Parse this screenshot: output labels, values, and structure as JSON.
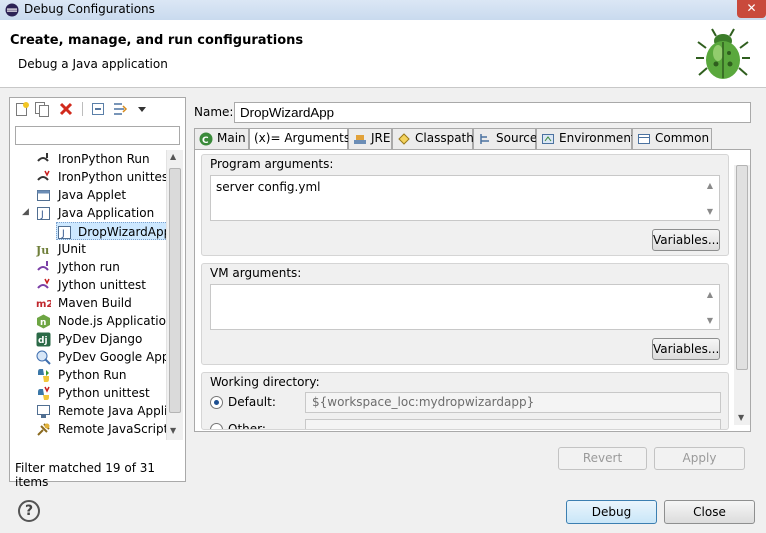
{
  "window": {
    "title": "Debug Configurations",
    "close_label": "✕"
  },
  "header": {
    "title": "Create, manage, and run configurations",
    "subtitle": "Debug a Java application"
  },
  "left": {
    "filter_placeholder": "",
    "tree": [
      {
        "label": "IronPython Run",
        "icon": "ironpython-run-icon",
        "depth": 1
      },
      {
        "label": "IronPython unittest",
        "icon": "ironpython-unittest-icon",
        "depth": 1
      },
      {
        "label": "Java Applet",
        "icon": "java-applet-icon",
        "depth": 1
      },
      {
        "label": "Java Application",
        "icon": "java-application-icon",
        "depth": 1,
        "expanded": true
      },
      {
        "label": "DropWizardApp",
        "icon": "java-config-icon",
        "depth": 2,
        "selected": true
      },
      {
        "label": "JUnit",
        "icon": "junit-icon",
        "depth": 1
      },
      {
        "label": "Jython run",
        "icon": "jython-run-icon",
        "depth": 1
      },
      {
        "label": "Jython unittest",
        "icon": "jython-unittest-icon",
        "depth": 1
      },
      {
        "label": "Maven Build",
        "icon": "maven-icon",
        "depth": 1
      },
      {
        "label": "Node.js Application",
        "icon": "nodejs-icon",
        "depth": 1
      },
      {
        "label": "PyDev Django",
        "icon": "django-icon",
        "depth": 1
      },
      {
        "label": "PyDev Google App E",
        "icon": "google-app-icon",
        "depth": 1
      },
      {
        "label": "Python Run",
        "icon": "python-run-icon",
        "depth": 1
      },
      {
        "label": "Python unittest",
        "icon": "python-unittest-icon",
        "depth": 1
      },
      {
        "label": "Remote Java Applic",
        "icon": "remote-java-icon",
        "depth": 1
      },
      {
        "label": "Remote JavaScript",
        "icon": "remote-javascript-icon",
        "depth": 1
      }
    ],
    "status": "Filter matched 19 of 31 items"
  },
  "config": {
    "name_label": "Name:",
    "name_value": "DropWizardApp",
    "tabs": [
      {
        "label": "Main",
        "icon": "main-icon"
      },
      {
        "label": "(x)= Arguments",
        "icon": "arguments-icon",
        "active": true
      },
      {
        "label": "JRE",
        "icon": "jre-icon"
      },
      {
        "label": "Classpath",
        "icon": "classpath-icon"
      },
      {
        "label": "Source",
        "icon": "source-icon"
      },
      {
        "label": "Environment",
        "icon": "environment-icon"
      },
      {
        "label": "Common",
        "icon": "common-icon"
      }
    ],
    "program_args": {
      "label": "Program arguments:",
      "value": "server config.yml",
      "variables_button": "Variables..."
    },
    "vm_args": {
      "label": "VM arguments:",
      "value": "",
      "variables_button": "Variables..."
    },
    "working_dir": {
      "label": "Working directory:",
      "default_label": "Default:",
      "default_value": "${workspace_loc:mydropwizardapp}",
      "other_label": "Other:"
    },
    "revert_button": "Revert",
    "apply_button": "Apply"
  },
  "footer": {
    "debug_button": "Debug",
    "close_button": "Close",
    "help_glyph": "?"
  }
}
